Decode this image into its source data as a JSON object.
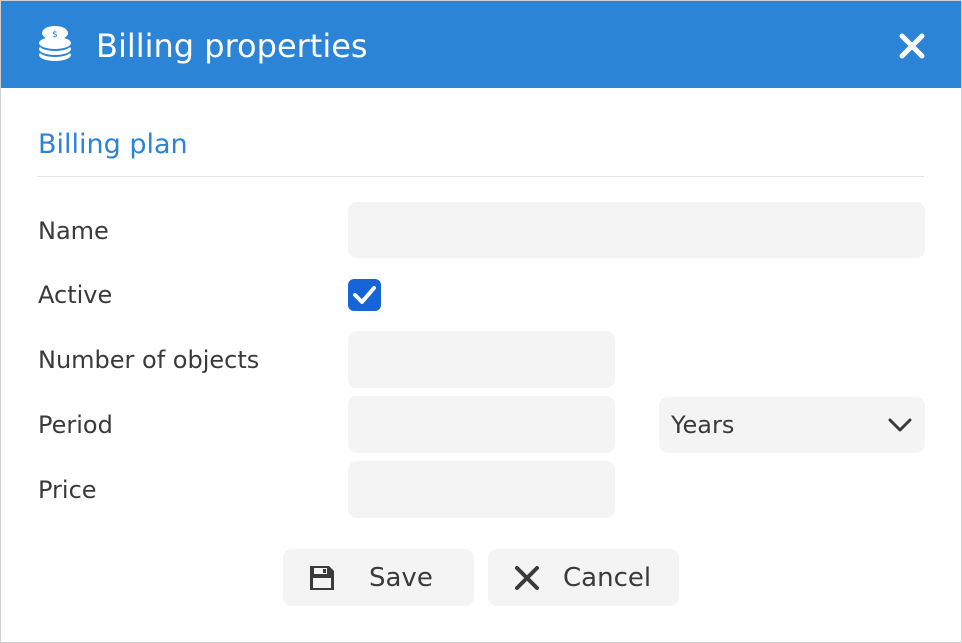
{
  "dialog": {
    "title": "Billing properties",
    "title_icon": "coins-icon",
    "close_icon": "close-icon"
  },
  "section": {
    "title": "Billing plan"
  },
  "form": {
    "name": {
      "label": "Name",
      "value": "",
      "placeholder": ""
    },
    "active": {
      "label": "Active",
      "checked": true
    },
    "objects": {
      "label": "Number of objects",
      "value": "",
      "placeholder": ""
    },
    "period": {
      "label": "Period",
      "value": "",
      "placeholder": "",
      "unit_selected": "Years"
    },
    "price": {
      "label": "Price",
      "value": "",
      "placeholder": ""
    }
  },
  "buttons": {
    "save": {
      "label": "Save",
      "icon": "floppy-disk-icon"
    },
    "cancel": {
      "label": "Cancel",
      "icon": "close-icon"
    }
  },
  "colors": {
    "accent": "#2b84d5",
    "checkbox": "#1565d8",
    "field_bg": "#f4f4f4",
    "text": "#3a3a3a"
  }
}
